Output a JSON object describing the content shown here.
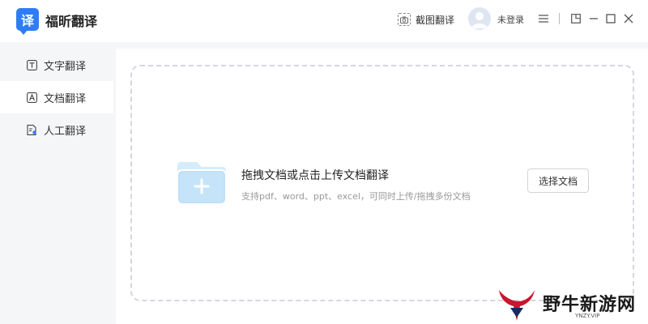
{
  "app": {
    "logo_char": "译",
    "name": "福昕翻译"
  },
  "header": {
    "screenshot_label": "截图翻译",
    "login_label": "未登录"
  },
  "sidebar": {
    "items": [
      {
        "label": "文字翻译",
        "icon": "text-translate-icon"
      },
      {
        "label": "文档翻译",
        "icon": "doc-translate-icon",
        "active": true
      },
      {
        "label": "人工翻译",
        "icon": "human-translate-icon"
      }
    ]
  },
  "dropzone": {
    "title": "拖拽文档或点击上传文档翻译",
    "subtitle": "支持pdf、word、ppt、excel，可同时上传/拖拽多份文档",
    "button_label": "选择文档"
  },
  "watermark": {
    "text": "野牛新游网",
    "sub": "YNZY.VIP"
  },
  "colors": {
    "accent": "#2f7cf6",
    "folder": "#bfe0f7"
  }
}
